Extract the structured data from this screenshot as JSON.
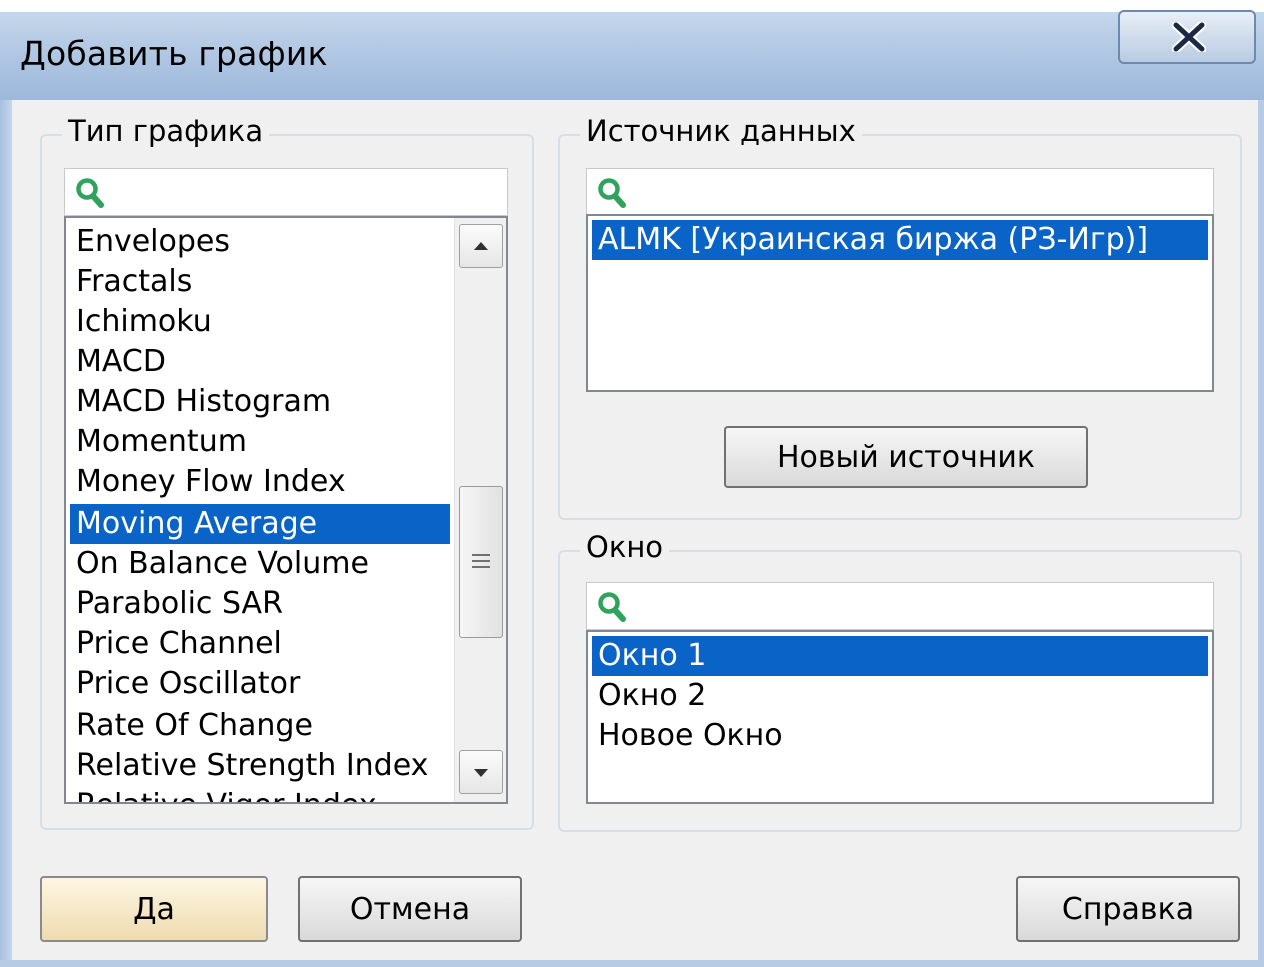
{
  "window": {
    "title": "Добавить график",
    "close_label": "X"
  },
  "chart_type": {
    "legend": "Тип графика",
    "search": {
      "value": "",
      "placeholder": ""
    },
    "items": [
      "Envelopes",
      "Fractals",
      "Ichimoku",
      "MACD",
      "MACD Histogram",
      "Momentum",
      "Money Flow Index",
      "Moving Average",
      "On Balance Volume",
      "Parabolic SAR",
      "Price Channel",
      "Price Oscillator",
      "Rate Of Change",
      "Relative Strength Index",
      "Relative Vigor Index"
    ],
    "selected": "Moving Average"
  },
  "data_source": {
    "legend": "Источник данных",
    "search": {
      "value": "",
      "placeholder": ""
    },
    "items": [
      "ALMK [Украинская биржа (РЗ-Игр)]"
    ],
    "selected": "ALMK [Украинская биржа (РЗ-Игр)]",
    "new_source_label": "Новый источник"
  },
  "window_group": {
    "legend": "Окно",
    "search": {
      "value": "",
      "placeholder": ""
    },
    "items": [
      "Окно 1",
      "Окно 2",
      "Новое Окно"
    ],
    "selected": "Окно 1"
  },
  "buttons": {
    "ok_label": "Да",
    "cancel_label": "Отмена",
    "help_label": "Справка"
  },
  "colors": {
    "selection": "#0a64c8",
    "titlebar": "#b9cde6",
    "search_icon": "#2fa35c"
  }
}
